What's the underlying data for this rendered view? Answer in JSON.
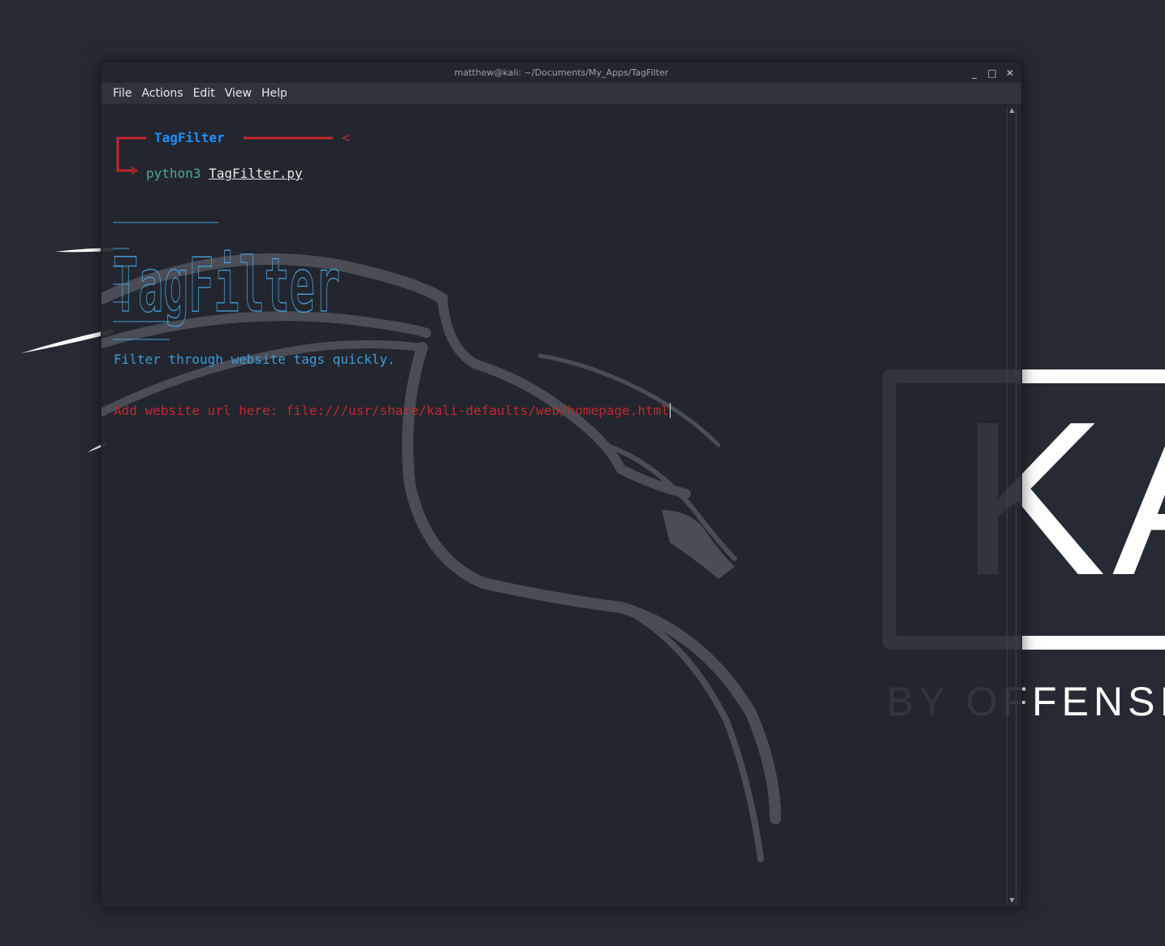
{
  "window": {
    "title": "matthew@kali: ~/Documents/My_Apps/TagFilter",
    "controls": [
      "minimize-icon",
      "maximize-icon",
      "close-icon"
    ]
  },
  "menu": [
    "File",
    "Actions",
    "Edit",
    "View",
    "Help"
  ],
  "terminal": {
    "prompt_title": "TagFilter",
    "prompt_suffix": "<",
    "command": "python3",
    "command_file": "TagFilter.py",
    "banner_text": "TagFilter",
    "tagline": "Filter through website tags quickly.",
    "url_label": "Add website url here: ",
    "url_value": "file:///usr/share/kali-defaults/web/homepage.html"
  },
  "wallpaper": {
    "logo_text": "KALI",
    "tagline": "BY OFFENSIVE"
  },
  "colors": {
    "prompt_red": "#c0282e",
    "prompt_blue": "#1e90ff",
    "tagline_blue": "#3d9ad6",
    "banner_blue": "#4aa3df"
  }
}
